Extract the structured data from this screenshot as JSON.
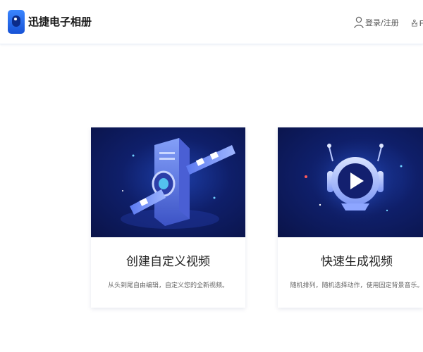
{
  "header": {
    "brand": "迅捷电子相册",
    "login_label": "登录/注册",
    "vip_label": "F"
  },
  "cards": [
    {
      "title": "创建自定义视频",
      "description": "从头到尾自由编辑，自定义您的全新视频。",
      "illustration": "film-projector-illustration"
    },
    {
      "title": "快速生成视频",
      "description": "随机排列，随机选择动作，使用固定背景音乐。",
      "illustration": "play-robot-illustration"
    }
  ],
  "colors": {
    "accent": "#2f6fff",
    "card_bg_dark": "#0a1348",
    "text_primary": "#222222"
  }
}
